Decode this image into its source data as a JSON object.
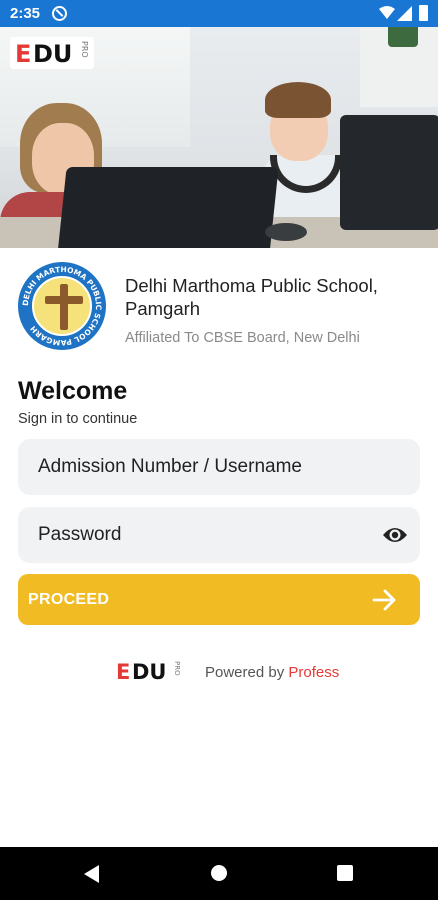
{
  "status_bar": {
    "time": "2:35",
    "color": "#1976d2"
  },
  "brand": {
    "logo_main": "EDU",
    "logo_sub": "PRO",
    "accent_color": "#e53935"
  },
  "school": {
    "name": "Delhi Marthoma Public School, Pamgarh",
    "affiliation": "Affiliated To CBSE Board, New Delhi",
    "logo_ring_text": "DELHI MARTHOMA PUBLIC SCHOOL PAMGARH"
  },
  "login": {
    "title": "Welcome",
    "subtitle": "Sign in to continue",
    "username_placeholder": "Admission Number / Username",
    "password_placeholder": "Password",
    "password_visibility_icon": "eye-icon",
    "proceed_label": "PROCEED",
    "proceed_icon": "arrow-right-icon",
    "proceed_color": "#f0bb23"
  },
  "footer": {
    "powered_by_prefix": "Powered by",
    "powered_by_brand": "Profess"
  },
  "nav_bar": {
    "back_icon": "back-triangle-icon",
    "home_icon": "home-circle-icon",
    "recent_icon": "recent-apps-square-icon"
  }
}
